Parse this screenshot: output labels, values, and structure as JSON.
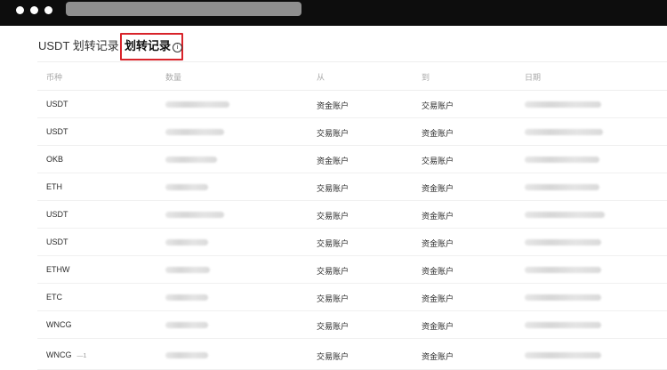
{
  "tabs": {
    "transfer": "USDT 划转记录",
    "records": "划转记录",
    "info_glyph": "i"
  },
  "table": {
    "headers": [
      "币种",
      "数量",
      "从",
      "到",
      "日期"
    ],
    "rows": [
      {
        "coin": "USDT",
        "from": "资金账户",
        "to": "交易账户"
      },
      {
        "coin": "USDT",
        "from": "交易账户",
        "to": "资金账户"
      },
      {
        "coin": "OKB",
        "from": "资金账户",
        "to": "交易账户"
      },
      {
        "coin": "ETH",
        "from": "交易账户",
        "to": "资金账户"
      },
      {
        "coin": "USDT",
        "from": "交易账户",
        "to": "资金账户"
      },
      {
        "coin": "USDT",
        "from": "交易账户",
        "to": "资金账户"
      },
      {
        "coin": "ETHW",
        "from": "交易账户",
        "to": "资金账户"
      },
      {
        "coin": "ETC",
        "from": "交易账户",
        "to": "资金账户"
      },
      {
        "coin": "WNCG",
        "from": "交易账户",
        "to": "资金账户"
      },
      {
        "coin": "WNCG",
        "from": "交易账户",
        "to": "资金账户",
        "extra": "—1"
      }
    ]
  },
  "colors": {
    "highlight_border": "#d8232a",
    "titlebar": "#0d0d0d"
  }
}
